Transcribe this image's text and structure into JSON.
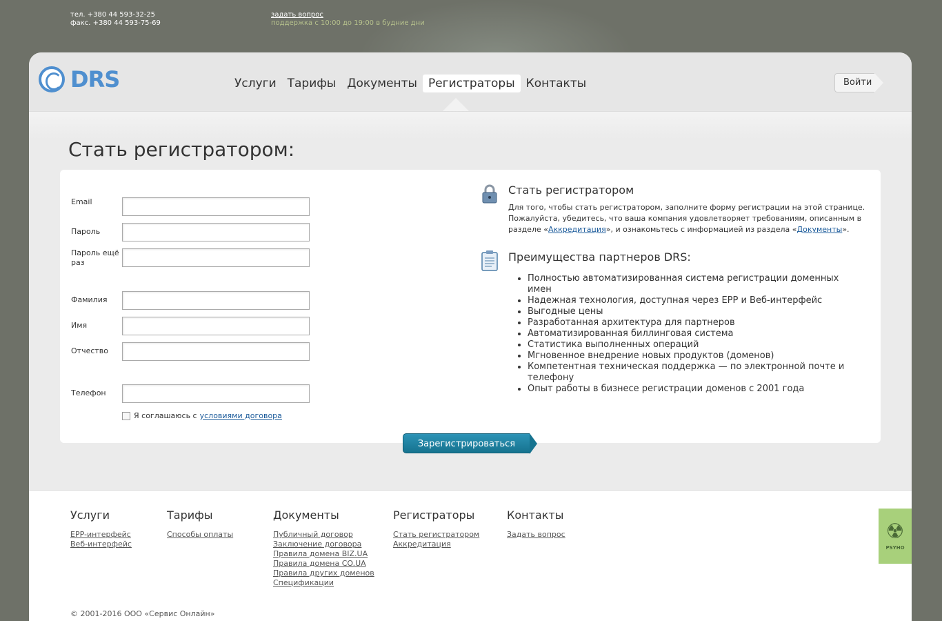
{
  "topbar": {
    "phone": "тел. +380 44 593-32-25",
    "fax": "факс. +380 44 593-75-69",
    "ask_link": "задать вопрос",
    "hours": "поддержка с 10:00 до 19:00 в будние дни"
  },
  "header": {
    "logo_text": "DRS",
    "nav": [
      "Услуги",
      "Тарифы",
      "Документы",
      "Регистраторы",
      "Контакты"
    ],
    "active_nav": "Регистраторы",
    "login_label": "Войти"
  },
  "main": {
    "title": "Стать регистратором:",
    "form": {
      "email_label": "Email",
      "password_label": "Пароль",
      "password_repeat_label": "Пароль ещё раз",
      "lastname_label": "Фамилия",
      "firstname_label": "Имя",
      "middlename_label": "Отчество",
      "phone_label": "Телефон",
      "agree_text": "Я соглашаюсь с",
      "agree_link": "условиями договора",
      "submit_label": "Зарегистрироваться"
    },
    "info": {
      "heading": "Стать регистратором",
      "text_1": "Для того, чтобы стать регистратором, заполните форму регистрации на этой странице. Пожалуйста, убедитесь, что ваша компания удовлетворяет требованиям, описанным в разделе «",
      "link_1": "Аккредитация",
      "text_2": "», и ознакомьтесь с информацией из раздела «",
      "link_2": "Документы",
      "text_3": "».",
      "benefits_heading": "Преимущества партнеров DRS:",
      "benefits": [
        "Полностью автоматизированная система регистрации доменных имен",
        "Надежная технология, доступная через EPP и Веб-интерфейс",
        "Выгодные цены",
        "Разработанная архитектура для партнеров",
        "Автоматизированная биллинговая система",
        "Статистика выполненных операций",
        "Мгновенное внедрение новых продуктов (доменов)",
        "Компетентная техническая поддержка — по электронной почте и телефону",
        "Опыт работы в бизнесе регистрации доменов с 2001 года"
      ]
    }
  },
  "footer": {
    "columns": [
      {
        "title": "Услуги",
        "links": [
          "EPP-интерфейс",
          "Веб-интерфейс"
        ]
      },
      {
        "title": "Тарифы",
        "links": [
          "Способы оплаты"
        ]
      },
      {
        "title": "Документы",
        "links": [
          "Публичный договор",
          "Заключение договора",
          "Правила домена BIZ.UA",
          "Правила домена CO.UA",
          "Правила других доменов",
          "Спецификации"
        ]
      },
      {
        "title": "Регистраторы",
        "links": [
          "Стать регистратором",
          "Аккредитация"
        ]
      },
      {
        "title": "Контакты",
        "links": [
          "Задать вопрос"
        ]
      }
    ],
    "copyright": "© 2001-2016 ООО «Сервис Онлайн»",
    "badge_label": "PSYHO"
  }
}
